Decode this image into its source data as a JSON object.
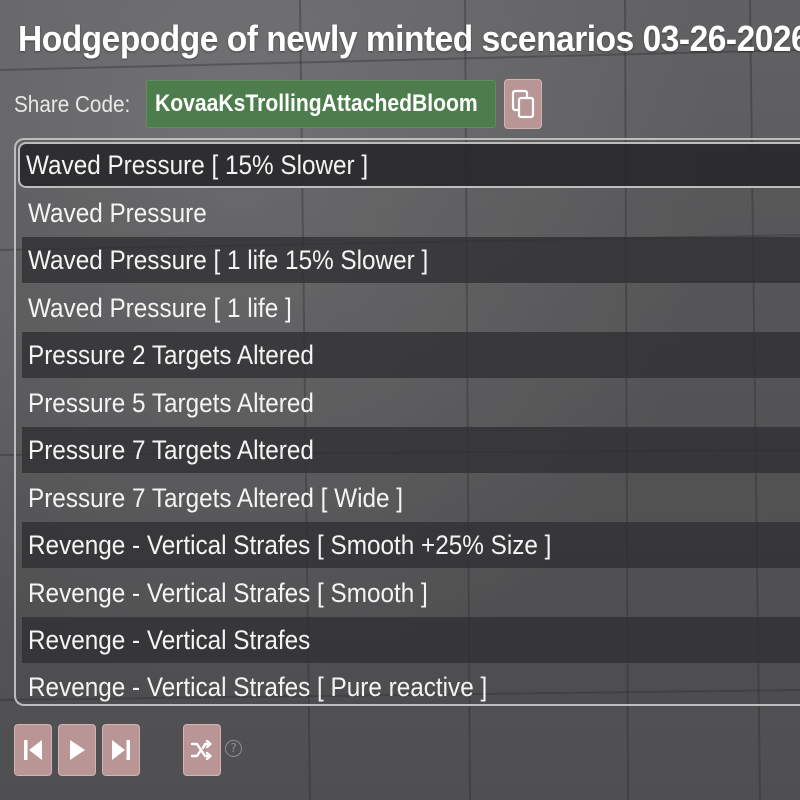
{
  "header": {
    "title": "Hodgepodge of newly minted scenarios 03-26-2026"
  },
  "share": {
    "label": "Share Code:",
    "code": "KovaaKsTrollingAttachedBloom",
    "copy_icon": "copy-icon"
  },
  "scenarios": [
    {
      "label": "Waved Pressure [ 15% Slower ]",
      "selected": true
    },
    {
      "label": "Waved Pressure",
      "selected": false
    },
    {
      "label": "Waved Pressure [ 1 life 15% Slower ]",
      "selected": false
    },
    {
      "label": "Waved Pressure [ 1 life ]",
      "selected": false
    },
    {
      "label": "Pressure 2 Targets Altered",
      "selected": false
    },
    {
      "label": "Pressure 5 Targets Altered",
      "selected": false
    },
    {
      "label": "Pressure 7 Targets Altered",
      "selected": false
    },
    {
      "label": "Pressure 7 Targets Altered [ Wide ]",
      "selected": false
    },
    {
      "label": "Revenge - Vertical Strafes  [ Smooth +25% Size ]",
      "selected": false
    },
    {
      "label": "Revenge - Vertical Strafes  [ Smooth ]",
      "selected": false
    },
    {
      "label": "Revenge - Vertical Strafes",
      "selected": false
    },
    {
      "label": "Revenge - Vertical Strafes  [ Pure reactive ]",
      "selected": false
    }
  ],
  "controls": {
    "icons": [
      "skip-to-start-icon",
      "play-icon",
      "skip-to-end-icon",
      "shuffle-icon",
      "help-icon"
    ],
    "help_symbol": "?"
  },
  "colors": {
    "share_code_bg": "#4d7d4c",
    "button_bg": "#b99595",
    "panel_border": "#bdbdbd"
  }
}
